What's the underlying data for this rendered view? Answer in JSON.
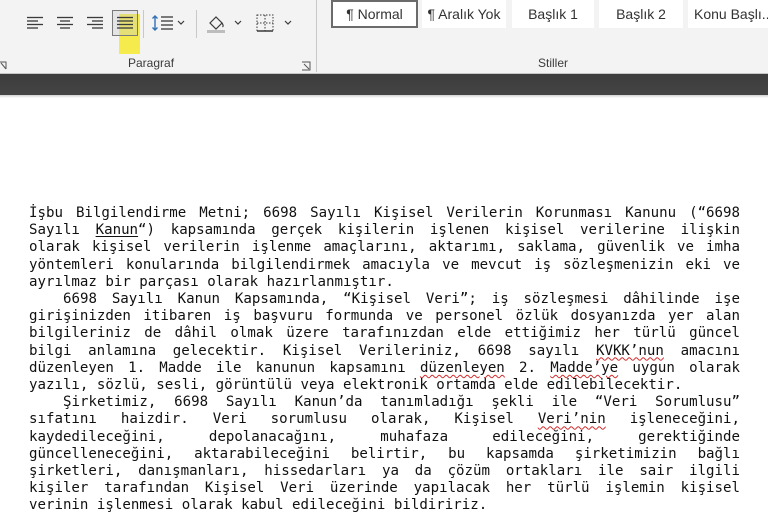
{
  "ribbon": {
    "paragraph_group": {
      "label": "Paragraf",
      "buttons": {
        "align_left": "align-left-icon",
        "align_center": "align-center-icon",
        "align_right": "align-right-icon",
        "justify": "justify-icon",
        "line_spacing": "line-spacing-icon",
        "shading": "paint-bucket-icon",
        "borders": "borders-icon"
      }
    },
    "styles_group": {
      "label": "Stiller",
      "items": [
        "¶ Normal",
        "¶ Aralık Yok",
        "Başlık 1",
        "Başlık 2",
        "Konu Başlı..."
      ],
      "selected": "¶ Normal"
    },
    "highlight_color": "#f5ea3a"
  },
  "document": {
    "p1_a": "İşbu Bilgilendirme Metni; 6698 Sayılı Kişisel Verilerin Korunması Kanunu (“6698 Sayılı ",
    "p1_b": "Kanun",
    "p1_c": "“) kapsamında gerçek kişilerin işlenen kişisel verilerine ilişkin olarak kişisel verilerin işlenme amaçlarını, aktarımı, saklama, güvenlik ve imha yöntemleri konularında bilgilendirmek amacıyla ve mevcut iş sözleşmenizin eki ve ayrılmaz bir parçası olarak hazırlanmıştır.",
    "p2_a": "6698 Sayılı Kanun Kapsamında, “Kişisel Veri”; iş sözleşmesi dâhilinde işe girişinizden itibaren iş başvuru formunda ve personel özlük dosyanızda yer alan bilgileriniz de dâhil olmak üzere tarafınızdan elde ettiğimiz her türlü güncel bilgi anlamına gelecektir. Kişisel Verileriniz, 6698 sayılı ",
    "p2_b": "KVKK’nun",
    "p2_c": " amacını düzenleyen 1. Madde ile kanunun kapsamını ",
    "p2_d": "düzenleyen",
    "p2_e": " 2. ",
    "p2_f": "Madde’ye",
    "p2_g": " uygun olarak yazılı, sözlü, sesli, görüntülü veya elektronik ortamda elde edilebilecektir.",
    "p3_a": "Şirketimiz, 6698 Sayılı Kanun’da tanımladığı şekli ile “Veri Sorumlusu” sıfatını haizdir. Veri sorumlusu olarak, Kişisel ",
    "p3_b": "Veri’nin",
    "p3_c": " işleneceğini, kaydedileceğini, depolanacağını, muhafaza edileceğini, gerektiğinde güncelleneceğini, aktarabileceğini belirtir, bu kapsamda şirketimizin bağlı şirketleri, danışmanları, hissedarları ya da çözüm ortakları ile sair ilgili kişiler tarafından Kişisel Veri üzerinde yapılacak her türlü işlemin kişisel verinin işlenmesi olarak kabul edileceğini bildiririz."
  }
}
